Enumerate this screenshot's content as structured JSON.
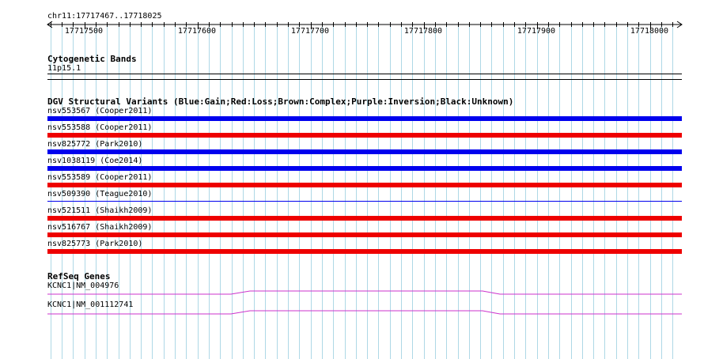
{
  "ruler": {
    "region": "chr11:17717467..17718025",
    "ticks": [
      "17717500",
      "17717600",
      "17717700",
      "17717800",
      "17717900",
      "17718000"
    ]
  },
  "cytoband": {
    "title": "Cytogenetic Bands",
    "band": "11p15.1"
  },
  "dgv": {
    "title": "DGV Structural Variants (Blue:Gain;Red:Loss;Brown:Complex;Purple:Inversion;Black:Unknown)",
    "variants": [
      {
        "label": "nsv553567 (Cooper2011)",
        "type": "gain",
        "color": "#0000ee"
      },
      {
        "label": "nsv553588 (Cooper2011)",
        "type": "loss",
        "color": "#ee0000"
      },
      {
        "label": "nsv825772 (Park2010)",
        "type": "gain",
        "color": "#0000ee"
      },
      {
        "label": "nsv1038119 (Coe2014)",
        "type": "gain",
        "color": "#0000ee"
      },
      {
        "label": "nsv553589 (Cooper2011)",
        "type": "loss",
        "color": "#ee0000"
      },
      {
        "label": "nsv509390 (Teague2010)",
        "type": "gain",
        "color": "#0000ee"
      },
      {
        "label": "nsv521511 (Shaikh2009)",
        "type": "loss",
        "color": "#ee0000"
      },
      {
        "label": "nsv516767 (Shaikh2009)",
        "type": "loss",
        "color": "#ee0000"
      },
      {
        "label": "nsv825773 (Park2010)",
        "type": "loss",
        "color": "#ee0000"
      }
    ]
  },
  "refseq": {
    "title": "RefSeq Genes",
    "genes": [
      {
        "label": "KCNC1|NM_004976",
        "color": "#cc33cc"
      },
      {
        "label": "KCNC1|NM_001112741",
        "color": "#cc33cc"
      }
    ]
  },
  "colors": {
    "grid_line": "#aed8e6",
    "gain": "#0000ee",
    "loss": "#ee0000",
    "gene": "#cc33cc"
  }
}
